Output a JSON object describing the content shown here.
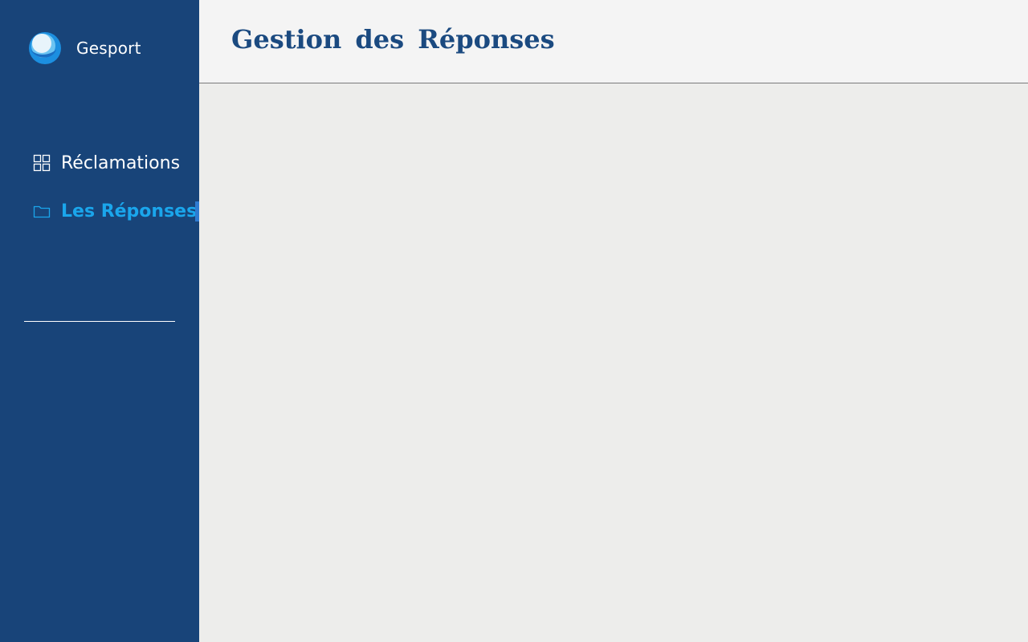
{
  "brand": {
    "name": "Gesport",
    "logo_icon": "wave-logo-icon"
  },
  "sidebar": {
    "items": [
      {
        "label": "Réclamations",
        "icon": "grid-icon",
        "active": false
      },
      {
        "label": "Les Réponses",
        "icon": "folder-icon",
        "active": true
      }
    ]
  },
  "header": {
    "title": "Gestion des Réponses"
  },
  "colors": {
    "sidebar_bg": "#184479",
    "active_text": "#1aa6ec",
    "title_text": "#1b4a80",
    "header_bg": "#f4f4f4",
    "content_bg": "#ededeb"
  }
}
